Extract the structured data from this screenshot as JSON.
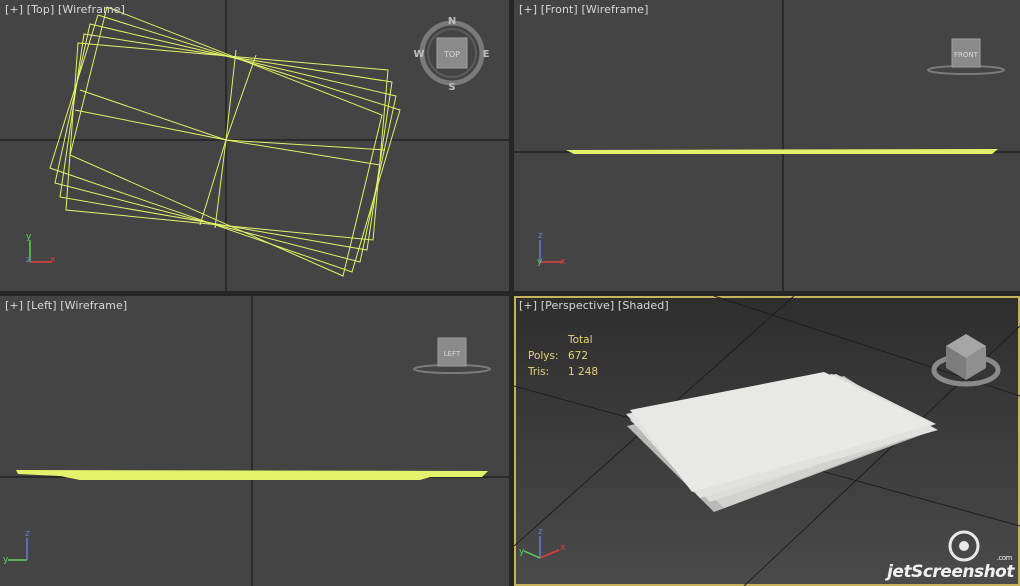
{
  "viewports": {
    "top": {
      "plus": "[+]",
      "view": "[Top]",
      "mode": "[Wireframe]"
    },
    "front": {
      "plus": "[+]",
      "view": "[Front]",
      "mode": "[Wireframe]"
    },
    "left": {
      "plus": "[+]",
      "view": "[Left]",
      "mode": "[Wireframe]"
    },
    "perspective": {
      "plus": "[+]",
      "view": "[Perspective]",
      "mode": "[Shaded]"
    }
  },
  "viewcube": {
    "top": {
      "face": "TOP",
      "compass": {
        "n": "N",
        "s": "S",
        "e": "E",
        "w": "W"
      }
    },
    "front": {
      "face": "FRONT"
    },
    "left": {
      "face": "LEFT"
    }
  },
  "stats": {
    "header": "Total",
    "polys_label": "Polys:",
    "polys_value": "672",
    "tris_label": "Tris:",
    "tris_value": "1 248"
  },
  "axes": {
    "x": "x",
    "y": "y",
    "z": "z"
  },
  "watermark": {
    "brand": "jetScreenshot",
    "suffix": ".com"
  },
  "colors": {
    "wire": "#e2f26a",
    "viewport_bg": "#444444",
    "active_border": "#c9b05a",
    "grid_axis": "#111111",
    "stats_text": "#e8d27a",
    "sheet": "#e8e8e4"
  }
}
